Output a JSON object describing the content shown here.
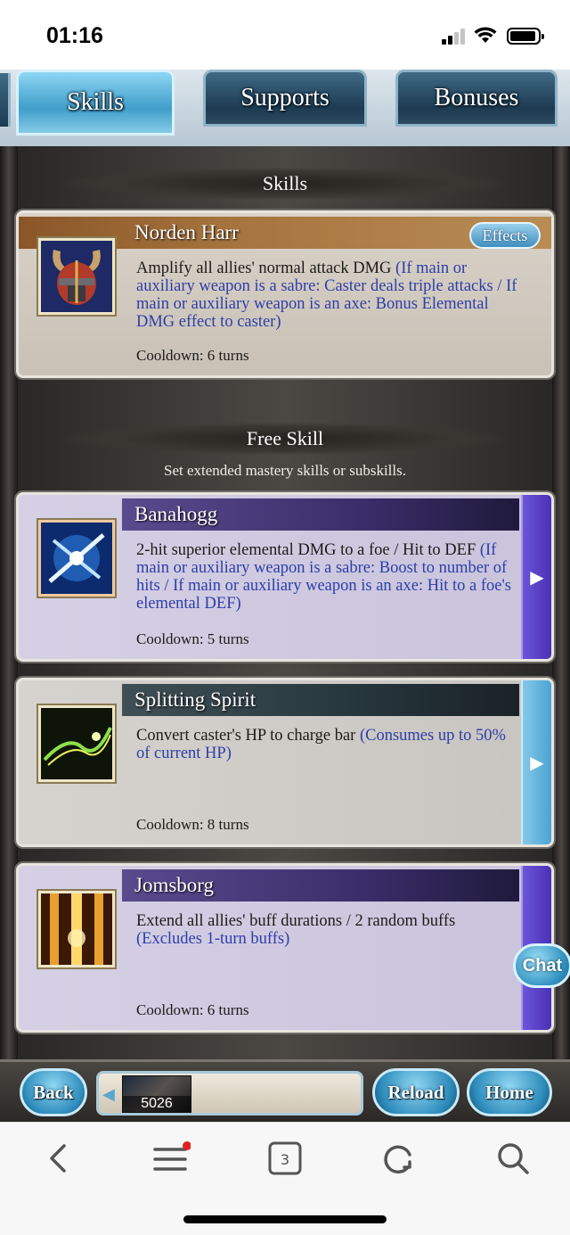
{
  "status": {
    "time": "01:16"
  },
  "tabs": [
    {
      "label": "Skills",
      "active": true
    },
    {
      "label": "Supports",
      "active": false
    },
    {
      "label": "Bonuses",
      "active": false
    }
  ],
  "skills_section": {
    "header": "Skills",
    "card": {
      "name": "Norden Harr",
      "effects_label": "Effects",
      "desc_plain": "Amplify all allies' normal attack DMG ",
      "desc_blue": "(If main or auxiliary weapon is a sabre: Caster deals triple attacks / If main or auxiliary weapon is an axe: Bonus Elemental DMG effect to caster)",
      "cooldown": "Cooldown: 6 turns",
      "icon": "horned-helmet-icon"
    }
  },
  "free_section": {
    "header": "Free Skill",
    "subtitle": "Set extended mastery skills or subskills.",
    "cards": [
      {
        "name": "Banahogg",
        "desc_plain": "2-hit superior elemental DMG to a foe / Hit to DEF ",
        "desc_blue": "(If main or auxiliary weapon is a sabre: Boost to number of hits / If main or auxiliary weapon is an axe: Hit to a foe's elemental DEF)",
        "cooldown": "Cooldown: 5 turns",
        "icon": "blue-slash-icon",
        "style": "violet"
      },
      {
        "name": "Splitting Spirit",
        "desc_plain": "Convert caster's HP to charge bar ",
        "desc_blue": "(Consumes up to 50% of current HP)",
        "cooldown": "Cooldown: 8 turns",
        "icon": "green-wisp-icon",
        "style": "grey"
      },
      {
        "name": "Jomsborg",
        "desc_plain": "Extend all allies' buff durations / 2 random buffs ",
        "desc_blue": "(Excludes 1-turn buffs)",
        "cooldown": "Cooldown: 6 turns",
        "icon": "fire-pillar-icon",
        "style": "violet"
      }
    ]
  },
  "chat_label": "Chat",
  "game_nav": {
    "back": "Back",
    "reload": "Reload",
    "home": "Home",
    "thumb_value": "5026"
  },
  "browser": {
    "tab_count": "3"
  },
  "colors": {
    "accent_blue": "#2d3ea8",
    "violet_bar": "#5a4a8e",
    "gold_bar": "#a6743e"
  }
}
